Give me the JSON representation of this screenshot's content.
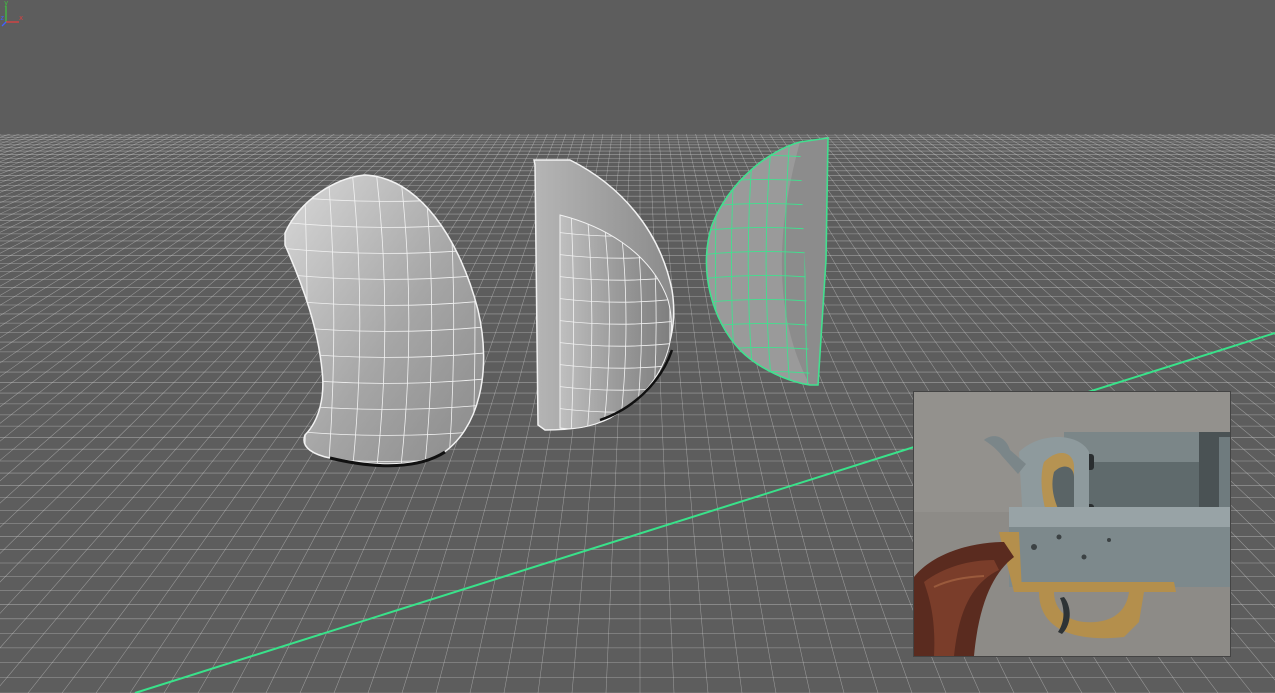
{
  "viewport": {
    "background": "#5d5d5d",
    "grid_color": "#d8d8d8",
    "x_axis_color": "#39e28a",
    "selection_color": "#41e08f"
  },
  "objects": [
    {
      "name": "curved-grip-wireframe",
      "state": "unselected"
    },
    {
      "name": "half-grip-wireframe",
      "state": "unselected"
    },
    {
      "name": "half-grip-selected",
      "state": "selected"
    }
  ],
  "reference_image": {
    "subject": "revolver-frame-photo",
    "colors": {
      "steel": "#7c8a8e",
      "brass": "#b48f4c",
      "wood": "#5a2b1f",
      "backdrop": "#8a8884"
    }
  },
  "axis_gizmo": {
    "x_label": "x",
    "y_label": "y",
    "z_label": "z",
    "x_color": "#e04040",
    "y_color": "#40c040",
    "z_color": "#4060ff"
  }
}
